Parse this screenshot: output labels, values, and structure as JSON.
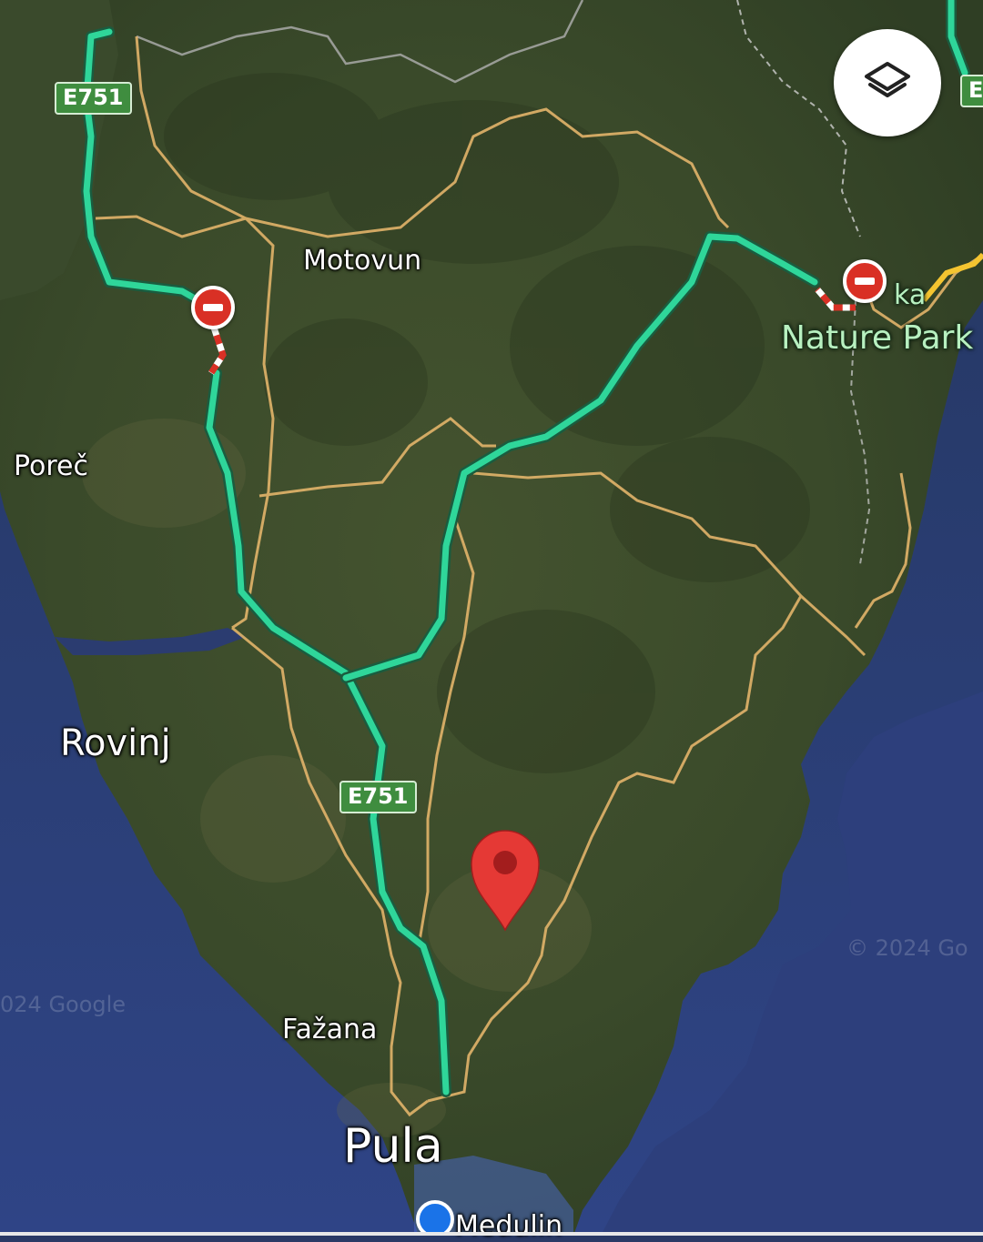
{
  "map": {
    "type": "satellite",
    "labels": {
      "motovun": "Motovun",
      "porec": "Poreč",
      "rovinj": "Rovinj",
      "fazana": "Fažana",
      "pula": "Pula",
      "medulin": "Medulin",
      "ucka_partial": "ka",
      "nature_park": "Nature Park"
    },
    "road_shields": {
      "shield_1": "E751",
      "shield_2": "E751",
      "shield_3_partial": "E"
    },
    "watermarks": {
      "left": "024 Google",
      "right": "© 2024 Go"
    },
    "colors": {
      "route_highlight": "#2fd69a",
      "road_outline": "#e2b46a",
      "closure": "#d93025",
      "pin": "#e53935",
      "location_dot": "#1a73e8",
      "sea": "#2d3f78",
      "land": "#3a4a2c"
    },
    "icons": {
      "layers_button": "layers-icon",
      "road_closure": "no-entry-icon",
      "destination": "map-pin-icon",
      "current_location": "location-dot-icon"
    }
  }
}
